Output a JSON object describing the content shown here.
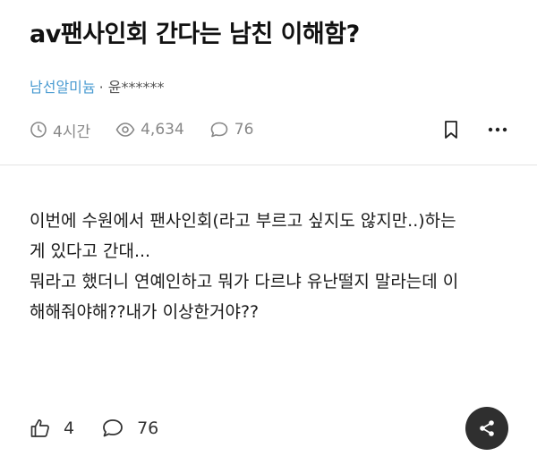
{
  "post": {
    "title": "av팬사인회 간다는 남친 이해함?",
    "board": "남선알미늄",
    "author": "· 윤******",
    "time": "4시간",
    "views": "4,634",
    "comments": "76"
  },
  "content": {
    "lines": [
      "이번에 수원에서 팬사인회(라고 부르고 싶지도 않지만..)하는",
      "게 있다고 간대...",
      "뭐라고 했더니 연예인하고 뭐가 다르냐 유난떨지 말라는데 이",
      "해해줘야해??내가 이상한거야??"
    ]
  },
  "footer": {
    "likes": "4",
    "comments": "76"
  },
  "icons": {
    "clock": "clock-icon",
    "eye": "eye-icon",
    "comment": "comment-icon",
    "bookmark": "bookmark-icon",
    "more": "more-icon",
    "thumbs_up": "thumbs-up-icon",
    "share": "share-icon"
  },
  "colors": {
    "board_link": "#4a9bd1",
    "meta_gray": "#888888",
    "share_button": "#2f2f2f"
  }
}
